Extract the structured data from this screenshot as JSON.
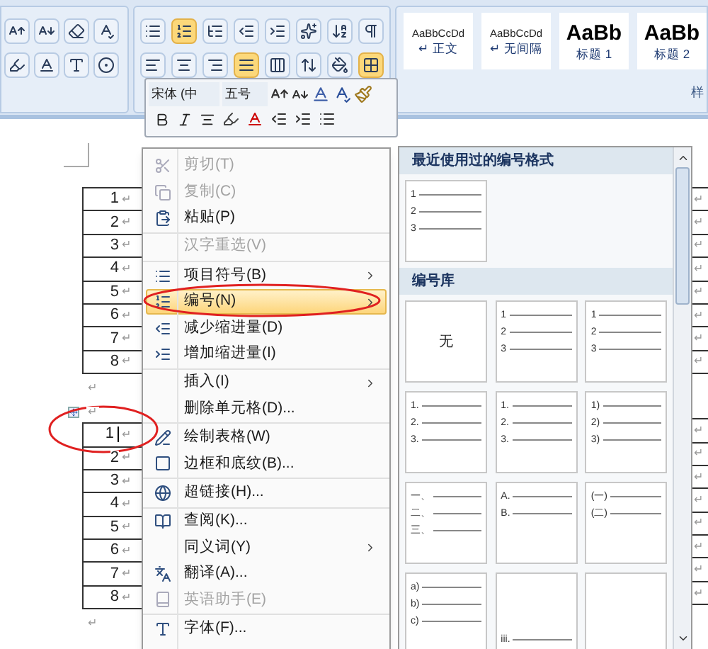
{
  "ribbon": {
    "styles": [
      {
        "sample": "AaBbCcDd",
        "mark": "↵",
        "name": "正文",
        "heading": false
      },
      {
        "sample": "AaBbCcDd",
        "mark": "↵",
        "name": "无间隔",
        "heading": false
      },
      {
        "sample": "AaBb",
        "name": "标题 1",
        "heading": true
      },
      {
        "sample": "AaBb",
        "name": "标题 2",
        "heading": true
      }
    ],
    "group_label": "样"
  },
  "mini_toolbar": {
    "font": "宋体 (中",
    "size": "五号"
  },
  "document": {
    "tables": [
      {
        "rows": [
          {
            "text": "1",
            "mark": "↵",
            "cursor": false
          },
          {
            "text": "2",
            "mark": "↵",
            "cursor": false
          },
          {
            "text": "3",
            "mark": "↵",
            "cursor": false
          },
          {
            "text": "4",
            "mark": "↵",
            "cursor": false
          },
          {
            "text": "5",
            "mark": "↵",
            "cursor": false
          },
          {
            "text": "6",
            "mark": "↵",
            "cursor": false
          },
          {
            "text": "7",
            "mark": "↵",
            "cursor": false
          },
          {
            "text": "8",
            "mark": "↵",
            "cursor": false
          }
        ],
        "after": "↵"
      },
      {
        "rows": [
          {
            "text": "1",
            "mark": "↵",
            "cursor": true
          },
          {
            "text": "2",
            "mark": "↵",
            "cursor": false
          },
          {
            "text": "3",
            "mark": "↵",
            "cursor": false
          },
          {
            "text": "4",
            "mark": "↵",
            "cursor": false
          },
          {
            "text": "5",
            "mark": "↵",
            "cursor": false
          },
          {
            "text": "6",
            "mark": "↵",
            "cursor": false
          },
          {
            "text": "7",
            "mark": "↵",
            "cursor": false
          },
          {
            "text": "8",
            "mark": "↵",
            "cursor": false
          }
        ],
        "before": "↵",
        "after": "↵"
      }
    ],
    "right_marks": [
      [
        "↵",
        "↵",
        "↵",
        "↵",
        "↵",
        "↵",
        "↵",
        "↵"
      ],
      [
        "↵",
        "↵",
        "↵",
        "↵",
        "↵",
        "↵",
        "↵",
        "↵"
      ]
    ]
  },
  "context_menu": {
    "groups": [
      [
        {
          "label": "剪切(T)",
          "disabled": true,
          "submenu": false,
          "selected": false
        },
        {
          "label": "复制(C)",
          "disabled": true,
          "submenu": false,
          "selected": false
        },
        {
          "label": "粘贴(P)",
          "disabled": false,
          "submenu": false,
          "selected": false
        }
      ],
      [
        {
          "label": "汉字重选(V)",
          "disabled": true,
          "submenu": false,
          "selected": false
        }
      ],
      [
        {
          "label": "项目符号(B)",
          "disabled": false,
          "submenu": true,
          "selected": false
        },
        {
          "label": "编号(N)",
          "disabled": false,
          "submenu": true,
          "selected": true
        },
        {
          "label": "减少缩进量(D)",
          "disabled": false,
          "submenu": false,
          "selected": false
        },
        {
          "label": "增加缩进量(I)",
          "disabled": false,
          "submenu": false,
          "selected": false
        }
      ],
      [
        {
          "label": "插入(I)",
          "disabled": false,
          "submenu": true,
          "selected": false
        },
        {
          "label": "删除单元格(D)...",
          "disabled": false,
          "submenu": false,
          "selected": false
        }
      ],
      [
        {
          "label": "绘制表格(W)",
          "disabled": false,
          "submenu": false,
          "selected": false
        },
        {
          "label": "边框和底纹(B)...",
          "disabled": false,
          "submenu": false,
          "selected": false
        }
      ],
      [
        {
          "label": "超链接(H)...",
          "disabled": false,
          "submenu": false,
          "selected": false
        }
      ],
      [
        {
          "label": "查阅(K)...",
          "disabled": false,
          "submenu": false,
          "selected": false
        },
        {
          "label": "同义词(Y)",
          "disabled": false,
          "submenu": true,
          "selected": false
        },
        {
          "label": "翻译(A)...",
          "disabled": false,
          "submenu": false,
          "selected": false
        },
        {
          "label": "英语助手(E)",
          "disabled": true,
          "submenu": false,
          "selected": false
        }
      ],
      [
        {
          "label": "字体(F)...",
          "disabled": false,
          "submenu": false,
          "selected": false
        }
      ]
    ]
  },
  "numbering_panel": {
    "sections": [
      {
        "title": "最近使用过的编号格式",
        "cells": [
          {
            "kind": "list",
            "labels": [
              "1",
              "2",
              "3"
            ]
          }
        ]
      },
      {
        "title": "编号库",
        "cells": [
          {
            "kind": "none",
            "text": "无"
          },
          {
            "kind": "list",
            "labels": [
              "1",
              "2",
              "3"
            ]
          },
          {
            "kind": "list",
            "labels": [
              "1",
              "2",
              "3"
            ]
          },
          {
            "kind": "list",
            "labels": [
              "1.",
              "2.",
              "3."
            ]
          },
          {
            "kind": "list",
            "labels": [
              "1.",
              "2.",
              "3."
            ]
          },
          {
            "kind": "list",
            "labels": [
              "1)",
              "2)",
              "3)"
            ]
          },
          {
            "kind": "list",
            "labels": [
              "一、",
              "二、",
              "三、"
            ]
          },
          {
            "kind": "list",
            "labels": [
              "A.",
              "B."
            ]
          },
          {
            "kind": "list",
            "labels": [
              "(一)",
              "(二)"
            ]
          },
          {
            "kind": "list",
            "labels": [
              "a)",
              "b)",
              "c)"
            ]
          },
          {
            "kind": "bottom",
            "labels": [
              "iii."
            ]
          },
          {
            "kind": "blank"
          }
        ]
      }
    ]
  }
}
